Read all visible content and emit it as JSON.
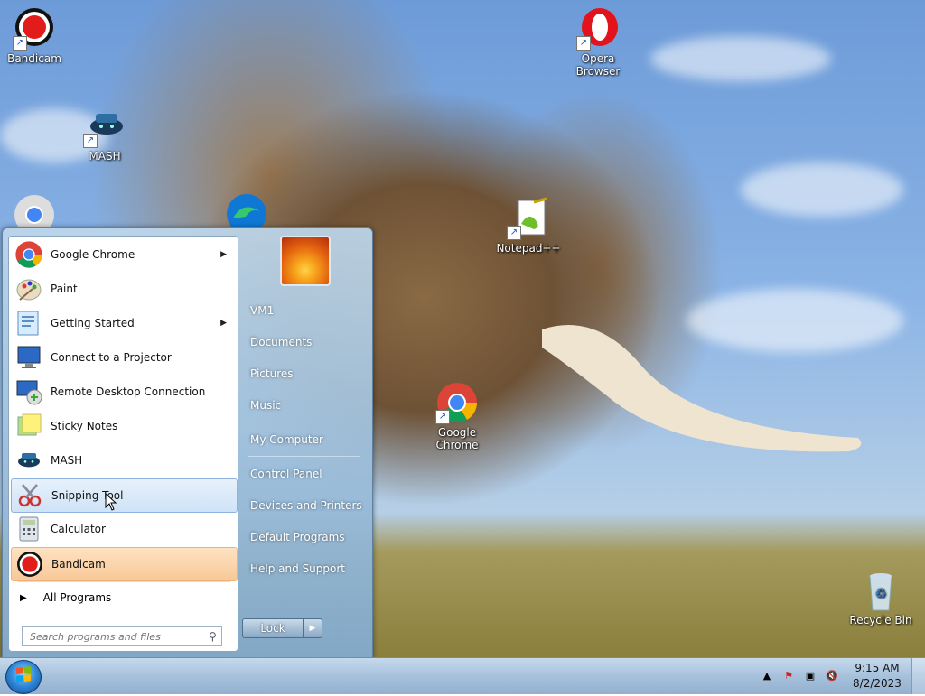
{
  "desktop": {
    "icons": [
      {
        "name": "Bandicam"
      },
      {
        "name": "MASH"
      },
      {
        "name": "Opera Browser"
      },
      {
        "name": "Notepad++"
      },
      {
        "name": "Google Chrome"
      },
      {
        "name": "Recycle Bin"
      }
    ]
  },
  "start_menu": {
    "programs": [
      {
        "label": "Google Chrome",
        "icon": "chrome-icon",
        "has_submenu": true
      },
      {
        "label": "Paint",
        "icon": "paint-icon",
        "has_submenu": false
      },
      {
        "label": "Getting Started",
        "icon": "getting-started-icon",
        "has_submenu": true
      },
      {
        "label": "Connect to a Projector",
        "icon": "projector-icon",
        "has_submenu": false
      },
      {
        "label": "Remote Desktop Connection",
        "icon": "remote-desktop-icon",
        "has_submenu": false
      },
      {
        "label": "Sticky Notes",
        "icon": "sticky-notes-icon",
        "has_submenu": false
      },
      {
        "label": "MASH",
        "icon": "mash-icon",
        "has_submenu": false
      },
      {
        "label": "Snipping Tool",
        "icon": "snipping-tool-icon",
        "has_submenu": false,
        "state": "hover"
      },
      {
        "label": "Calculator",
        "icon": "calculator-icon",
        "has_submenu": false
      },
      {
        "label": "Bandicam",
        "icon": "bandicam-icon",
        "has_submenu": false,
        "state": "highlighted"
      }
    ],
    "all_programs": "All Programs",
    "search_placeholder": "Search programs and files",
    "right_items": [
      "VM1",
      "Documents",
      "Pictures",
      "Music",
      "My Computer",
      "Control Panel",
      "Devices and Printers",
      "Default Programs",
      "Help and Support"
    ],
    "lock_label": "Lock"
  },
  "taskbar": {
    "time": "9:15 AM",
    "date": "8/2/2023"
  },
  "colors": {
    "hover_bg": "#cfe3f7",
    "highlight_bg": "#f8c897",
    "taskbar_bg": "#a7c1dc"
  }
}
